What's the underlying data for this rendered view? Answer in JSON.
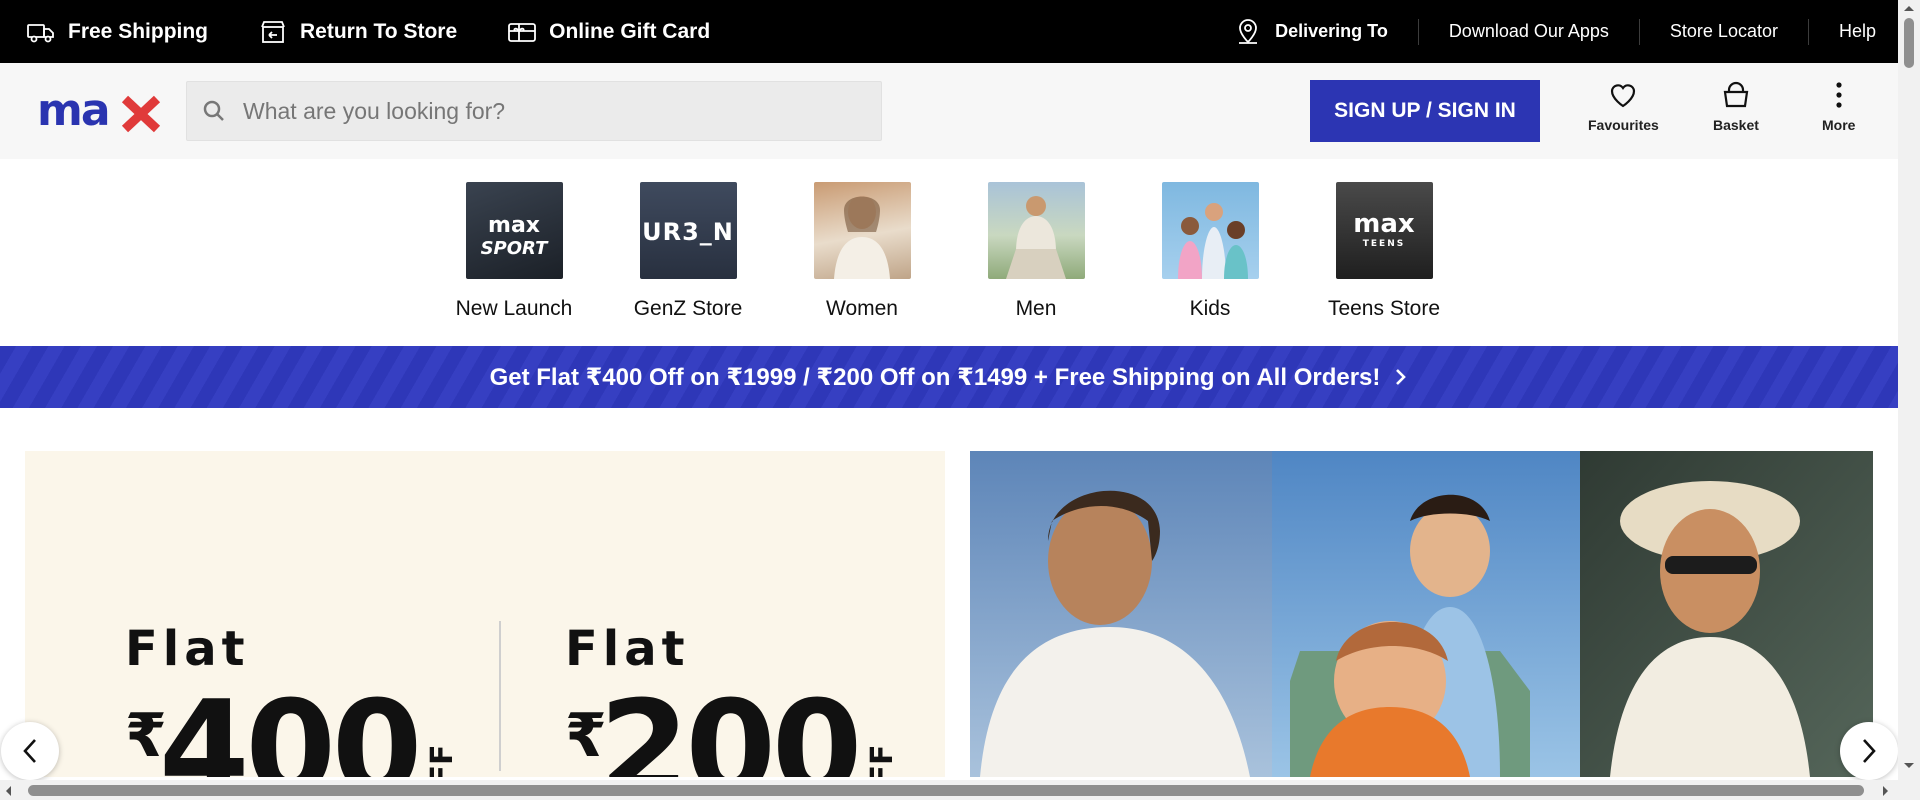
{
  "topbar": {
    "free_shipping": "Free Shipping",
    "return_to_store": "Return To Store",
    "gift_card": "Online Gift Card",
    "delivering_to": "Delivering To",
    "download_apps": "Download Our Apps",
    "store_locator": "Store Locator",
    "help": "Help"
  },
  "header": {
    "logo_text": "max",
    "search_placeholder": "What are you looking for?",
    "signin_label": "SIGN UP / SIGN IN",
    "favourites_label": "Favourites",
    "basket_label": "Basket",
    "more_label": "More"
  },
  "categories": [
    {
      "label": "New Launch",
      "thumb_text": "max SPORT",
      "icon": "max-sport-tile"
    },
    {
      "label": "GenZ Store",
      "thumb_text": "UR3_N",
      "icon": "urban-tile"
    },
    {
      "label": "Women",
      "thumb_text": "",
      "icon": "women-photo"
    },
    {
      "label": "Men",
      "thumb_text": "",
      "icon": "men-photo"
    },
    {
      "label": "Kids",
      "thumb_text": "",
      "icon": "kids-photo"
    },
    {
      "label": "Teens Store",
      "thumb_text": "max TEENS",
      "icon": "max-teens-tile"
    }
  ],
  "promo": {
    "text": "Get Flat ₹400 Off on ₹1999 / ₹200 Off on ₹1499 + Free Shipping on All Orders!"
  },
  "hero": {
    "offer1_flat": "Flat",
    "offer1_amount": "400",
    "offer1_off": "OFF",
    "offer2_flat": "Flat",
    "offer2_amount": "200",
    "offer2_off": "OFF",
    "currency": "₹"
  },
  "colors": {
    "brand_blue": "#2c35b3",
    "logo_blue": "#2a34b0",
    "logo_red": "#e03a3a",
    "topbar_bg": "#000000"
  }
}
